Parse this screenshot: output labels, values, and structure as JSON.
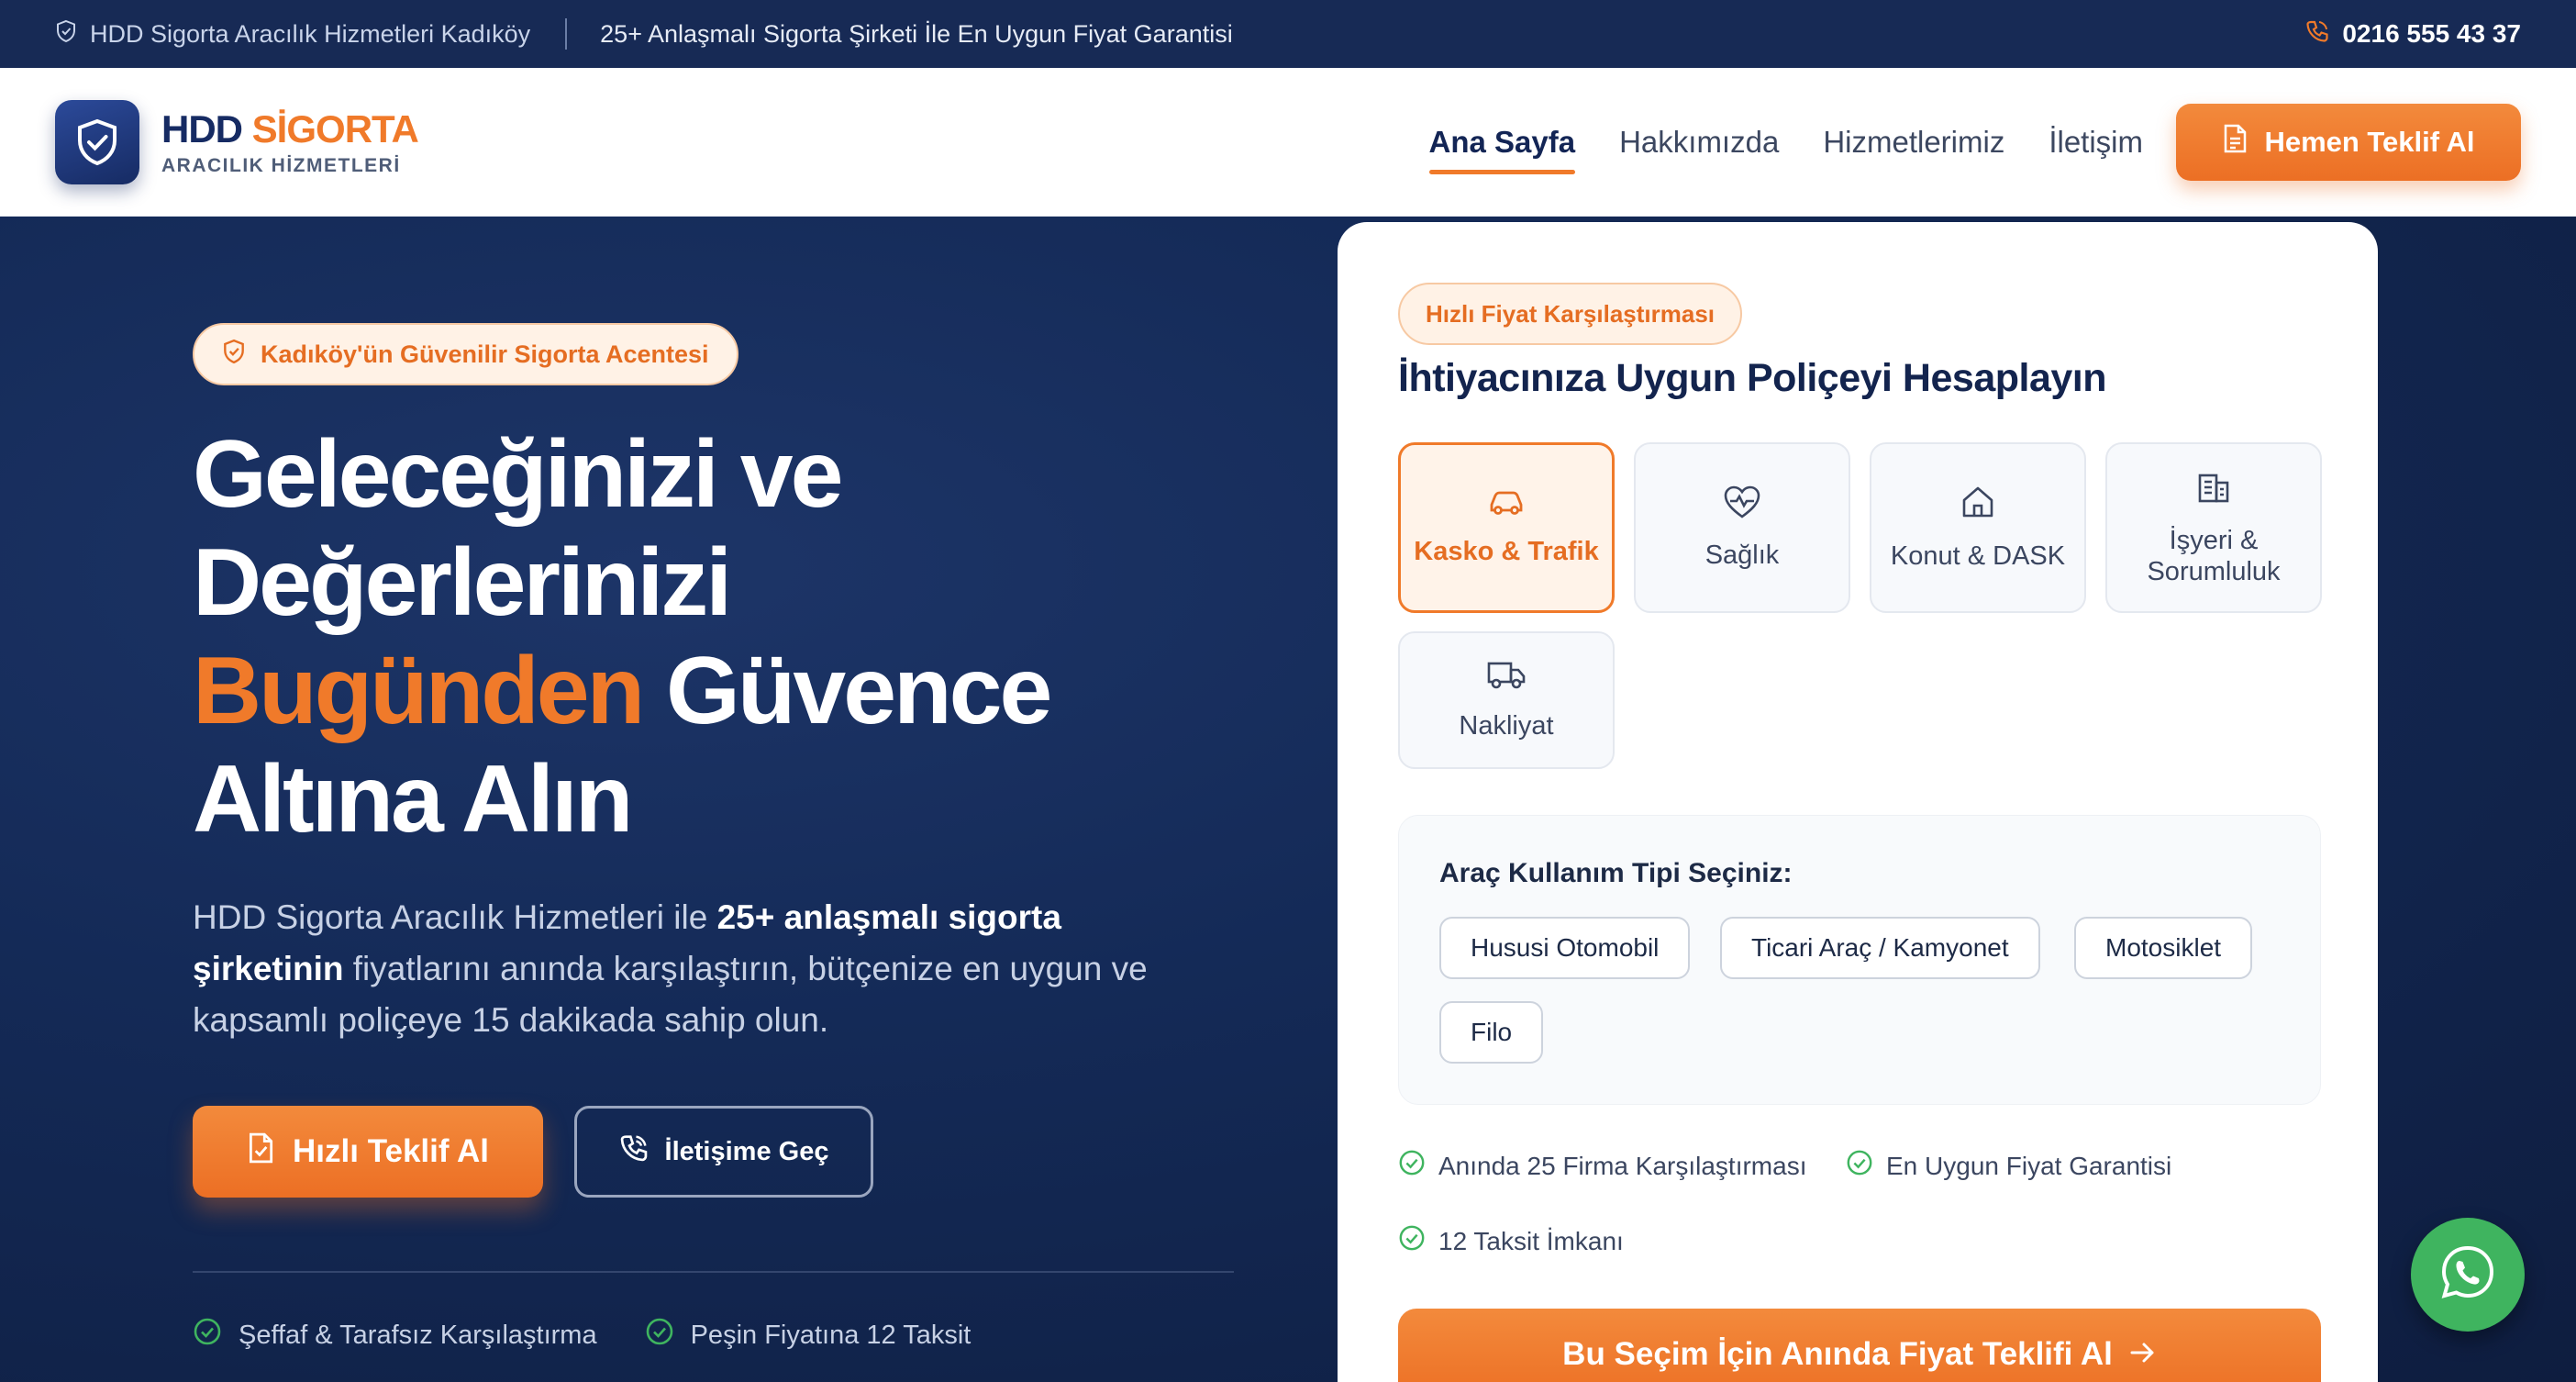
{
  "topbar": {
    "location": "HDD Sigorta Aracılık Hizmetleri Kadıköy",
    "promo": "25+ Anlaşmalı Sigorta Şirketi İle En Uygun Fiyat Garantisi",
    "phone": "0216 555 43 37"
  },
  "header": {
    "brand_a": "HDD",
    "brand_b": "SİGORTA",
    "brand_sub": "ARACILIK HİZMETLERİ",
    "nav": [
      "Ana Sayfa",
      "Hakkımızda",
      "Hizmetlerimiz",
      "İletişim"
    ],
    "cta": "Hemen Teklif Al"
  },
  "hero": {
    "badge": "Kadıköy'ün Güvenilir Sigorta Acentesi",
    "headline_1": "Geleceğinizi ve",
    "headline_2": "Değerlerinizi",
    "headline_orange": "Bugünden",
    "headline_3": " Güvence",
    "headline_4": "Altına Alın",
    "desc_1": "HDD Sigorta Aracılık Hizmetleri ile ",
    "desc_bold": "25+ anlaşmalı sigorta şirketinin",
    "desc_2": " fiyatlarını anında karşılaştırın, bütçenize en uygun ve kapsamlı poliçeye 15 dakikada sahip olun.",
    "btn_primary": "Hızlı Teklif Al",
    "btn_secondary": "İletişime Geç",
    "features": [
      "Şeffaf & Tarafsız Karşılaştırma",
      "Peşin Fiyatına 12 Taksit"
    ]
  },
  "card": {
    "badge": "Hızlı Fiyat Karşılaştırması",
    "title": "İhtiyacınıza Uygun Poliçeyi Hesaplayın",
    "tiles": [
      "Kasko & Trafik",
      "Sağlık",
      "Konut & DASK",
      "İşyeri & Sorumluluk",
      "Nakliyat"
    ],
    "usage_title": "Araç Kullanım Tipi Seçiniz:",
    "usage": [
      "Hususi Otomobil",
      "Ticari Araç / Kamyonet",
      "Motosiklet",
      "Filo"
    ],
    "checks": [
      "Anında 25 Firma Karşılaştırması",
      "En Uygun Fiyat Garantisi",
      "12 Taksit İmkanı"
    ],
    "cta": "Bu Seçim İçin Anında Fiyat Teklifi Al"
  },
  "colors": {
    "navy": "#162b63",
    "orange": "#f07a2a",
    "green": "#3fb45f"
  }
}
